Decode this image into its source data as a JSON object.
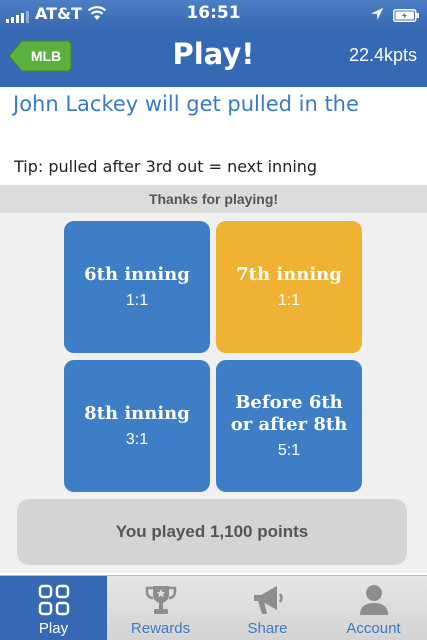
{
  "status_bar": {
    "carrier": "AT&T",
    "time": "16:51"
  },
  "nav": {
    "back_label": "MLB",
    "title": "Play!",
    "points": "22.4kpts"
  },
  "question": {
    "text": "John Lackey will get pulled in the",
    "tip": "Tip: pulled after 3rd out = next inning"
  },
  "banner": "Thanks for playing!",
  "options": [
    {
      "label": "6th inning",
      "odds": "1:1",
      "color": "#3e7ec6"
    },
    {
      "label": "7th inning",
      "odds": "1:1",
      "color": "#efb233"
    },
    {
      "label": "8th inning",
      "odds": "3:1",
      "color": "#3e7ec6"
    },
    {
      "label": "Before 6th or after 8th",
      "odds": "5:1",
      "color": "#3e7ec6"
    }
  ],
  "played_message": "You played 1,100 points",
  "tabs": [
    {
      "label": "Play",
      "icon": "grid-icon",
      "active": true
    },
    {
      "label": "Rewards",
      "icon": "trophy-icon",
      "active": false
    },
    {
      "label": "Share",
      "icon": "megaphone-icon",
      "active": false
    },
    {
      "label": "Account",
      "icon": "person-icon",
      "active": false
    }
  ],
  "colors": {
    "brand_blue": "#3569b3",
    "accent_gold": "#efb233",
    "button_green": "#5cb13e"
  }
}
